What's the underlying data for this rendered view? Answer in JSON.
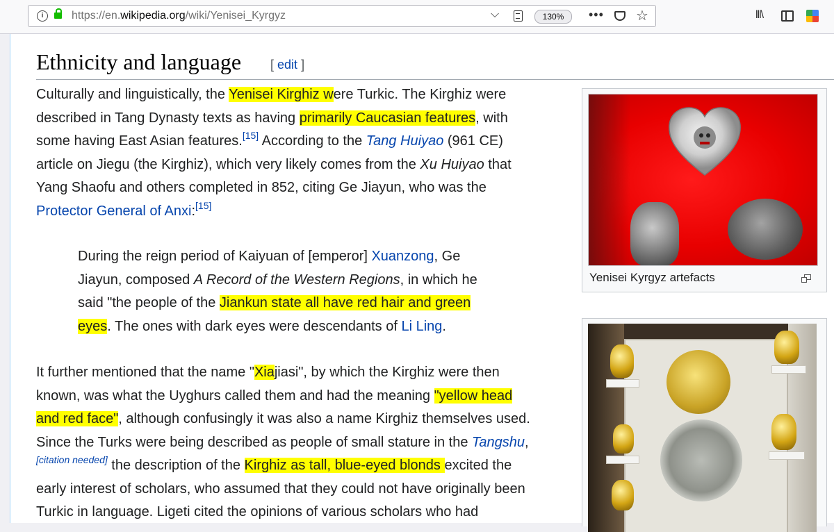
{
  "browser": {
    "url_scheme": "https://en.",
    "url_host": "wikipedia.org",
    "url_path": "/wiki/Yenisei_Kyrgyz",
    "zoom": "130%",
    "more_label": "•••",
    "star_label": "☆",
    "chevron_label": "⌵",
    "library_label": "lll\\"
  },
  "section": {
    "title": "Ethnicity and language",
    "edit_open": "[",
    "edit_label": "edit",
    "edit_close": "]"
  },
  "para1": {
    "l1a": "Culturally and linguistically, the ",
    "l1b": "Yenisei Kirghiz w",
    "l1c": "ere Turkic. The Kirghiz were",
    "l2a": "described in Tang Dynasty texts as having ",
    "l2b": "primarily Caucasian features",
    "l2c": ", with",
    "l3a": "some having East Asian features.",
    "l3ref": "[15]",
    "l3b": " According to the ",
    "l3link": "Tang Huiyao",
    "l3c": " (961 CE)",
    "l4a": "article on Jiegu (the Kirghiz), which very likely comes from the ",
    "l4i": "Xu Huiyao",
    "l4b": " that",
    "l5": "Yang Shaofu and others completed in 852, citing Ge Jiayun, who was the",
    "l6link": "Protector General of Anxi",
    "l6a": ":",
    "l6ref": "[15]"
  },
  "quote": {
    "l1a": "During the reign period of Kaiyuan of [emperor] ",
    "l1link": "Xuanzong",
    "l1b": ", Ge",
    "l2a": "Jiayun, composed ",
    "l2i": "A Record of the Western Regions",
    "l2b": ", in which he",
    "l3a": "said \"the people of the ",
    "l3b": "Jiankun state all have red hair and green",
    "l4a": "eyes",
    "l4b": ". The ones with dark eyes were descendants of ",
    "l4link": "Li Ling",
    "l4c": "."
  },
  "para2": {
    "l1a": "It further mentioned that the name \"",
    "l1b": "Xia",
    "l1c": "jiasi\", by which the Kirghiz were then",
    "l2a": "known, was what the Uyghurs called them and had the meaning ",
    "l2b": "\"yellow head",
    "l3a": "and red face\"",
    "l3b": ", although confusingly it was also a name Kirghiz themselves used.",
    "l4a": "Since the Turks were being described as people of small stature in the ",
    "l4link": "Tangshu",
    "l4b": ",",
    "l5open": "[",
    "l5cite": "citation needed",
    "l5close": "]",
    "l5a": " the description of the ",
    "l5b": "Kirghiz as tall, blue-eyed blonds ",
    "l5c": "excited the",
    "l6": "early interest of scholars, who assumed that they could not have originally been",
    "l7": "Turkic in language. Ligeti cited the opinions of various scholars who had"
  },
  "thumb1": {
    "caption": "Yenisei Kyrgyz artefacts"
  },
  "colors": {
    "link": "#0645ad",
    "highlight": "#ffff00",
    "lock": "#12bc00"
  }
}
